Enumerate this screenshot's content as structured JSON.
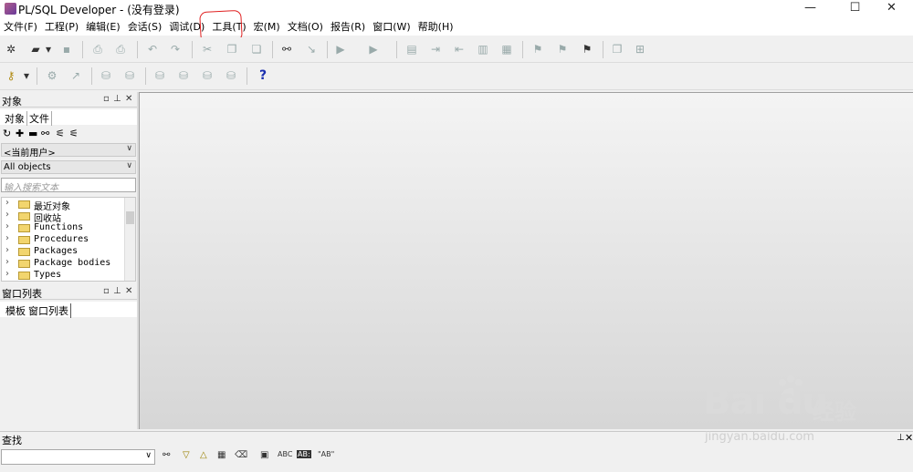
{
  "window": {
    "title": "PL/SQL Developer - (没有登录)",
    "minimize": "—",
    "maximize": "☐",
    "close": "✕"
  },
  "menu": [
    "文件(F)",
    "工程(P)",
    "编辑(E)",
    "会话(S)",
    "调试(D)",
    "工具(T)",
    "宏(M)",
    "文档(O)",
    "报告(R)",
    "窗口(W)",
    "帮助(H)"
  ],
  "help_icon": "?",
  "object_panel": {
    "title": "对象",
    "tabs": [
      "对象",
      "文件"
    ],
    "user_select": "<当前用户>",
    "filter_select": "All objects",
    "search_placeholder": "输入搜索文本",
    "tree": [
      "最近对象",
      "回收站",
      "Functions",
      "Procedures",
      "Packages",
      "Package bodies",
      "Types"
    ]
  },
  "window_list_panel": {
    "title": "窗口列表",
    "tabs": [
      "模板",
      "窗口列表"
    ]
  },
  "find_bar": {
    "title": "查找",
    "abc_label": "ABC",
    "abc_boxed_label": "AB:",
    "quoted_label": "\"AB\""
  },
  "watermark": {
    "logo": "Bai du",
    "brand_cn": "经验",
    "url": "jingyan.baidu.com"
  },
  "colors": {
    "highlight_circle": "#e02020",
    "help_icon": "#1a2fb0",
    "folder": "#f2d56e"
  }
}
